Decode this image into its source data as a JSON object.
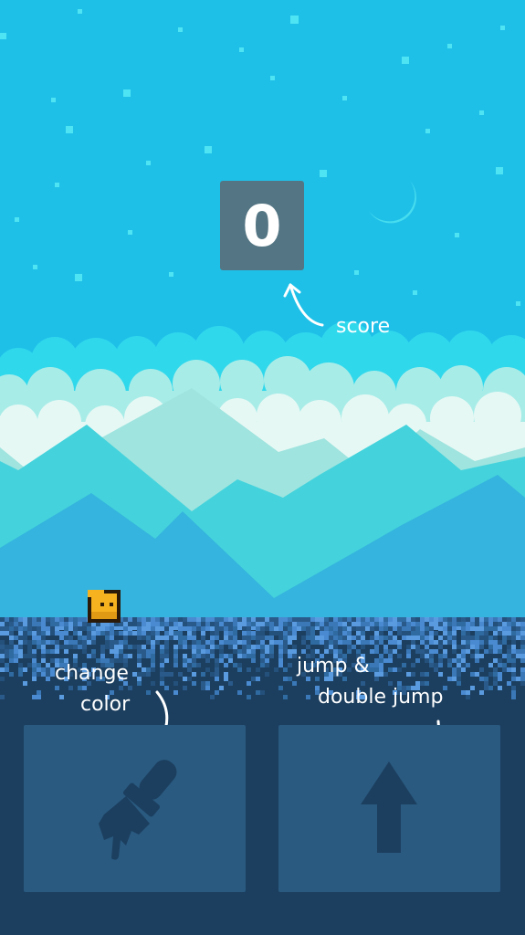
{
  "hud": {
    "score": "0",
    "score_hint": "score"
  },
  "controls": {
    "color_hint_line1": "change",
    "color_hint_line2": "color",
    "jump_hint_line1": "jump &",
    "jump_hint_line2": "double jump",
    "color_icon": "paint-brush-icon",
    "jump_icon": "arrow-up-icon"
  },
  "colors": {
    "sky": "#1fc0e8",
    "stars": "#4fe4f4",
    "moon": "#47ddef",
    "clouds_back": "#30d8ec",
    "clouds_mid": "#a8ece8",
    "clouds_front": "#e6f8f4",
    "mountain_pale": "#9fe4df",
    "mountain_mid": "#44d3dc",
    "mountain_front": "#34b4de",
    "ground_top": "#5a9be0",
    "ground_dark": "#1c3f5f",
    "button_bg": "#2a5a80",
    "player": "#f6b21f",
    "score_box": "#547684"
  }
}
